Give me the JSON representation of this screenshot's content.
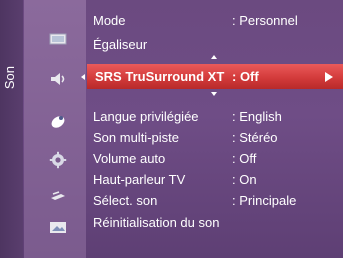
{
  "side": {
    "label": "Son"
  },
  "menu": {
    "top": [
      {
        "label": "Mode",
        "value": ": Personnel"
      },
      {
        "label": "Égaliseur",
        "value": ""
      }
    ],
    "selected": {
      "label": "SRS TruSurround XT",
      "value": ": Off"
    },
    "items": [
      {
        "label": "Langue privilégiée",
        "value": ": English",
        "disabled": true
      },
      {
        "label": "Son multi-piste",
        "value": ": Stéréo",
        "disabled": false
      },
      {
        "label": "Volume auto",
        "value": ": Off",
        "disabled": false
      },
      {
        "label": "Haut-parleur TV",
        "value": ": On",
        "disabled": false
      },
      {
        "label": "Sélect. son",
        "value": ": Principale",
        "disabled": true
      },
      {
        "label": "Réinitialisation du son",
        "value": "",
        "disabled": false
      }
    ]
  },
  "icons": [
    "picture-icon",
    "sound-icon",
    "satellite-dish-icon",
    "gear-icon",
    "input-icon",
    "application-icon"
  ],
  "colors": {
    "panel": "#6b4a80",
    "highlight": "#d33b3b",
    "disabled_text": "#a98bb8"
  }
}
